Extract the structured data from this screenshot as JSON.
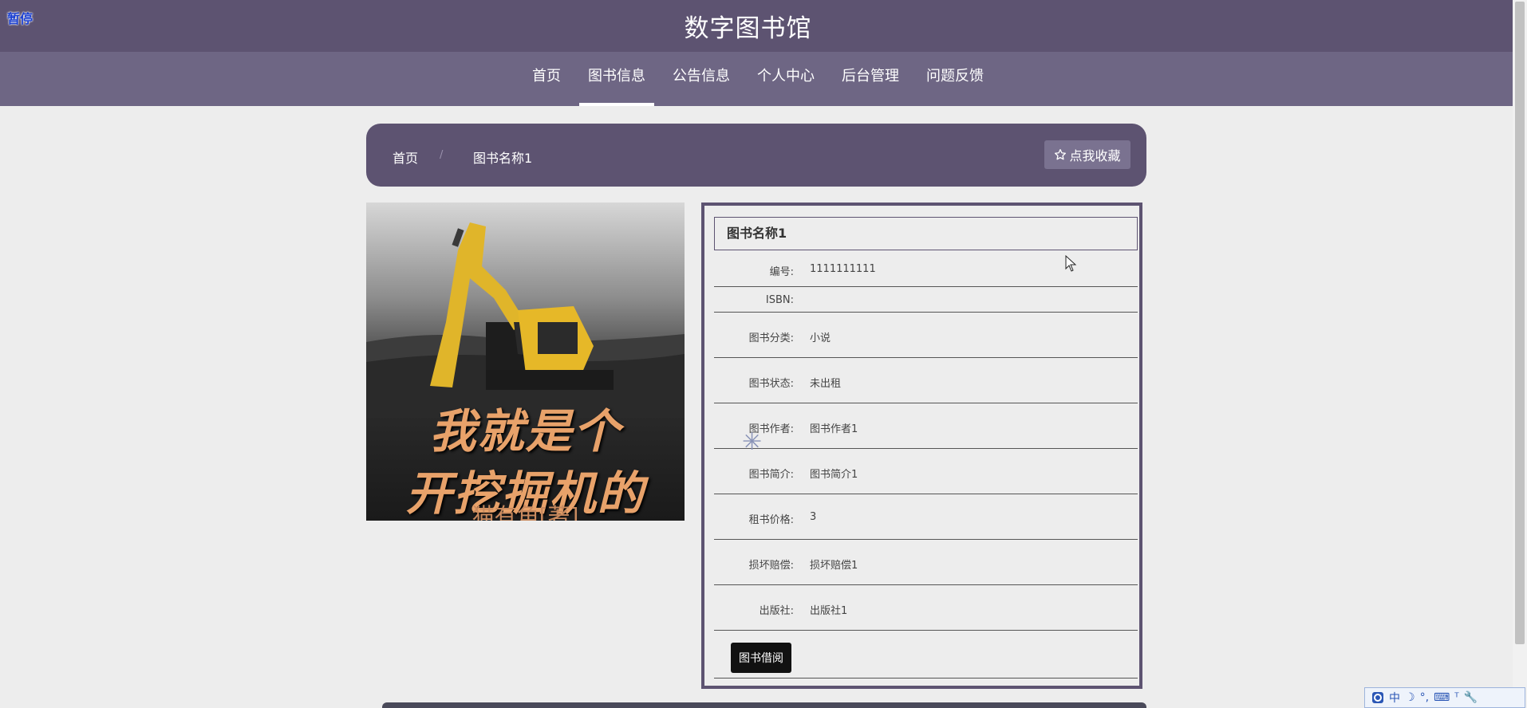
{
  "header": {
    "pause_label": "暂停",
    "site_title": "数字图书馆"
  },
  "nav": {
    "items": [
      {
        "label": "首页",
        "active": false
      },
      {
        "label": "图书信息",
        "active": true
      },
      {
        "label": "公告信息",
        "active": false
      },
      {
        "label": "个人中心",
        "active": false
      },
      {
        "label": "后台管理",
        "active": false
      },
      {
        "label": "问题反馈",
        "active": false
      }
    ]
  },
  "breadcrumb": {
    "home": "首页",
    "separator": "/",
    "current": "图书名称1",
    "favorite_label": "点我收藏",
    "favorite_icon": "star-outline-icon"
  },
  "cover": {
    "line1": "我就是个",
    "line2": "开挖掘机的",
    "author": "猫有角[著]"
  },
  "detail": {
    "title": "图书名称1",
    "fields": [
      {
        "label": "编号:",
        "value": "1111111111"
      },
      {
        "label": "ISBN:",
        "value": ""
      },
      {
        "label": "图书分类:",
        "value": "小说"
      },
      {
        "label": "图书状态:",
        "value": "未出租"
      },
      {
        "label": "图书作者:",
        "value": "图书作者1"
      },
      {
        "label": "图书简介:",
        "value": "图书简介1"
      },
      {
        "label": "租书价格:",
        "value": "3"
      },
      {
        "label": "损坏赔偿:",
        "value": "损坏赔偿1"
      },
      {
        "label": "出版社:",
        "value": "出版社1"
      }
    ],
    "borrow_label": "图书借阅"
  },
  "ime": {
    "items": [
      "中",
      "☽",
      "°,",
      "⌨",
      "ᵀ",
      "🔧"
    ]
  },
  "colors": {
    "header": "#5d5371",
    "nav": "#6e6684",
    "background": "#ededed",
    "borrow_button": "#111111"
  }
}
